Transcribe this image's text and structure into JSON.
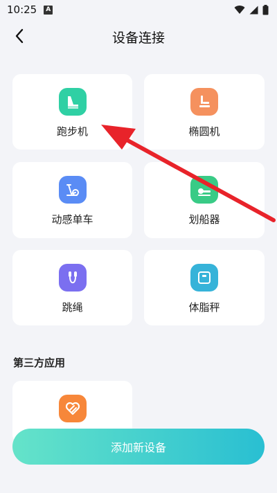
{
  "status_bar": {
    "time": "10:25",
    "badge": "A"
  },
  "header": {
    "title": "设备连接"
  },
  "devices": [
    {
      "label": "跑步机",
      "icon": "treadmill-icon",
      "color": "#2fd0a4"
    },
    {
      "label": "椭圆机",
      "icon": "elliptical-icon",
      "color": "#f5915e"
    },
    {
      "label": "动感单车",
      "icon": "spin-bike-icon",
      "color": "#5a8cf5"
    },
    {
      "label": "划船器",
      "icon": "rowing-machine-icon",
      "color": "#39cb86"
    },
    {
      "label": "跳绳",
      "icon": "jump-rope-icon",
      "color": "#7b6ff0"
    },
    {
      "label": "体脂秤",
      "icon": "body-fat-scale-icon",
      "color": "#36b3d9"
    }
  ],
  "third_party": {
    "title": "第三方应用",
    "apps": [
      {
        "icon": "health-app-icon",
        "color": "#f7873a"
      }
    ]
  },
  "add_button": {
    "label": "添加新设备"
  },
  "annotation": {
    "arrow_color": "#e8232a"
  }
}
